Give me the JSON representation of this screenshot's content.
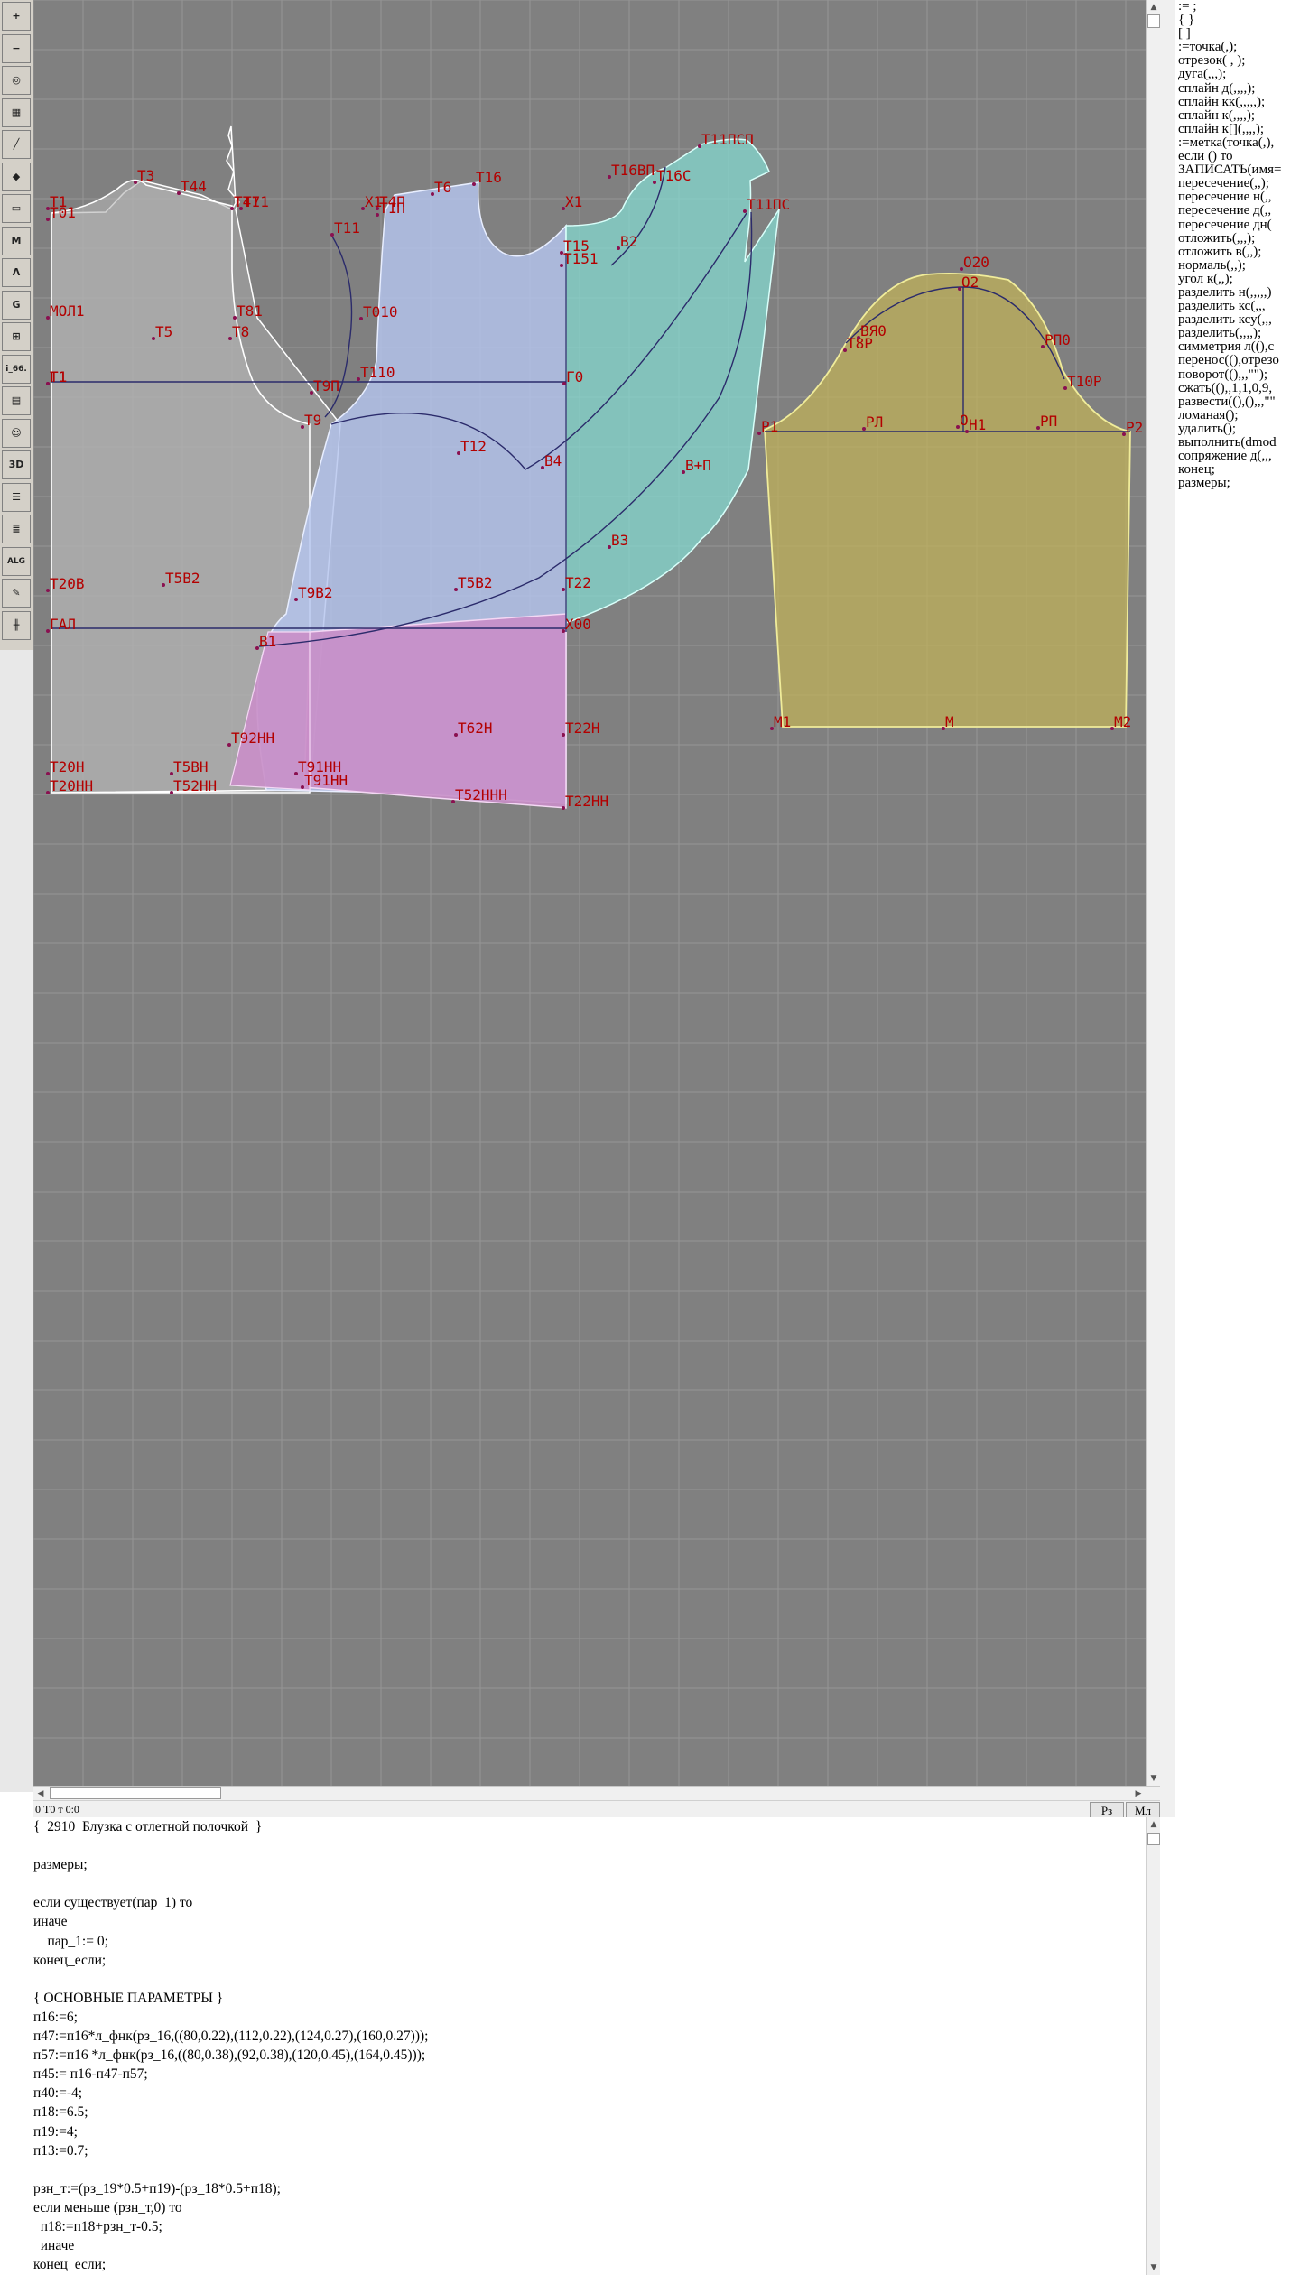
{
  "toolbar": {
    "tools": [
      {
        "icon": "zoom-in-icon",
        "label": "+"
      },
      {
        "icon": "zoom-out-icon",
        "label": "−"
      },
      {
        "icon": "zoom-fit-icon",
        "label": "◎"
      },
      {
        "icon": "grid-icon",
        "label": "▦"
      },
      {
        "icon": "line-tool-icon",
        "label": "╱"
      },
      {
        "icon": "layer-icon",
        "label": "◆"
      },
      {
        "icon": "piece-icon",
        "label": "▭"
      },
      {
        "icon": "measure-icon",
        "label": "M"
      },
      {
        "icon": "compass-icon",
        "label": "Λ"
      },
      {
        "icon": "gauge-icon",
        "label": "G"
      },
      {
        "icon": "ruler-icon",
        "label": "⊞"
      },
      {
        "icon": "model-id-label",
        "label": "i_66."
      },
      {
        "icon": "page-icon",
        "label": "▤"
      },
      {
        "icon": "portrait-icon",
        "label": "☺"
      },
      {
        "icon": "3d-view-icon",
        "label": "3D"
      },
      {
        "icon": "document-icon",
        "label": "☰"
      },
      {
        "icon": "stack-icon",
        "label": "≣"
      },
      {
        "icon": "algorithm-icon",
        "label": "ALG"
      },
      {
        "icon": "pen-tool-icon",
        "label": "✎"
      },
      {
        "icon": "split-tool-icon",
        "label": "╫"
      }
    ]
  },
  "canvas": {
    "background": "#808080",
    "point_labels": [
      "Т3",
      "Т44",
      "Т41",
      "Т1",
      "Т01",
      "Т71",
      "МОЛ1",
      "Т5",
      "Т81",
      "Т8",
      "Т1",
      "Т9П",
      "Т11",
      "Х1",
      "Т4П",
      "Т6",
      "Т16",
      "Т010",
      "Т1П",
      "Т16ВП",
      "Т16С",
      "Т11ПСП",
      "Т11ПС",
      "Х1",
      "Т15",
      "Т151",
      "В2",
      "Т110",
      "Г0",
      "Г1",
      "Т9",
      "Т12",
      "В4",
      "В+П",
      "В3",
      "Т20В",
      "Т5В2",
      "Т9В2",
      "Т5В2",
      "Т22",
      "ГАЛ",
      "Х00",
      "В1",
      "Т62Н",
      "Т22Н",
      "Т92НН",
      "Т20Н",
      "Т20НН",
      "Т5ВН",
      "Т52НН",
      "Т91НН",
      "Т91НН",
      "Т52ННН",
      "Т22НН",
      "О20",
      "О2",
      "ВЯ0",
      "Т8Р",
      "РП0",
      "Т10Р",
      "Р1",
      "РЛ",
      "О",
      "Н1",
      "РП",
      "Р2",
      "М1",
      "М",
      "М2"
    ]
  },
  "status_bar": {
    "coords": "0  Т0 т 0:0",
    "btn_rz": "Рз",
    "btn_ml": "Мл"
  },
  "command_palette": [
    ":= ;",
    "{  }",
    "[  ]",
    ":=точка(,);",
    "отрезок( , );",
    "дуга(,,,);",
    "сплайн  д(,,,,);",
    "сплайн  кк(,,,,,);",
    "сплайн  к(,,,,);",
    "сплайн  к[](,,,,);",
    ":=метка(точка(,),",
    "если () то",
    "ЗАПИСАТЬ(имя=",
    "пересечение(,,);",
    "пересечение  н(,,",
    "пересечение  д(,,",
    "пересечение  дн(",
    "отложить(,,,);",
    "отложить  в(,,);",
    "нормаль(,,);",
    "угол  к(,,);",
    "разделить  н(,,,,,)",
    "разделить  кс(,,,",
    "разделить  ксу(,,,",
    "разделить(,,,,);",
    "симметрия  л((),с",
    "перенос((),отрезо",
    "поворот((),,,\"\");",
    "сжать((),,1,1,0,9,",
    "развести((),(),,,\"\"",
    "ломаная();",
    "удалить();",
    "выполнить(dmod",
    "сопряжение  д(,,,",
    "конец;",
    "размеры;"
  ],
  "script_editor": {
    "lines": [
      "{  2910  Блузка с отлетной полочкой  }",
      "",
      "размеры;",
      "",
      "если существует(пар_1) то",
      "иначе",
      "    пар_1:= 0;",
      "конец_если;",
      "",
      "{ ОСНОВНЫЕ ПАРАМЕТРЫ }",
      "п16:=6;",
      "п47:=п16*л_фнк(рз_16,((80,0.22),(112,0.22),(124,0.27),(160,0.27)));",
      "п57:=п16 *л_фнк(рз_16,((80,0.38),(92,0.38),(120,0.45),(164,0.45)));",
      "п45:= п16-п47-п57;",
      "п40:=-4;",
      "п18:=6.5;",
      "п19:=4;",
      "п13:=0.7;",
      "",
      "рзн_т:=(рз_19*0.5+п19)-(рз_18*0.5+п18);",
      "если меньше (рзн_т,0) то",
      "  п18:=п18+рзн_т-0.5;",
      "  иначе",
      "конец_если;"
    ]
  }
}
